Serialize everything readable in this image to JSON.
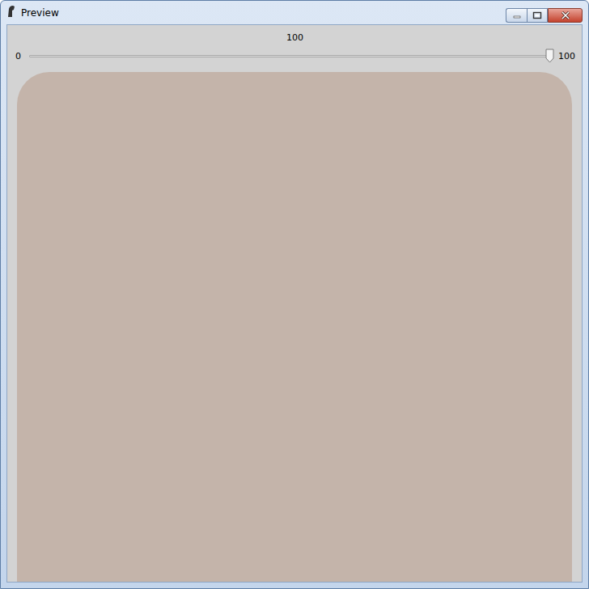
{
  "window": {
    "title": "Preview"
  },
  "slider": {
    "value": "100",
    "min": "0",
    "max": "100",
    "level": 1
  }
}
